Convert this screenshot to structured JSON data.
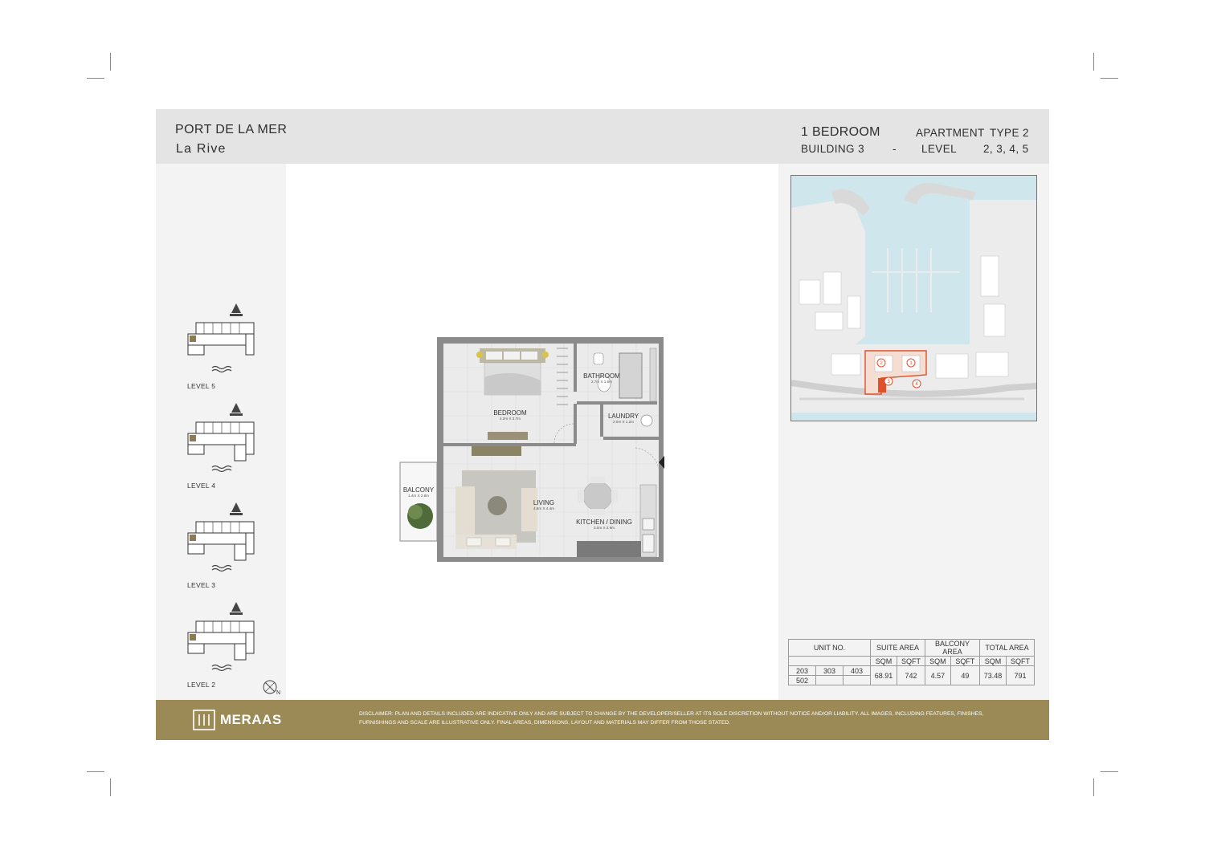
{
  "header": {
    "project": "PORT DE LA MER",
    "subproject": "La Rive",
    "unit_type": "1 BEDROOM",
    "apartment_label": "APARTMENT",
    "apartment_type": "TYPE 2",
    "building": "BUILDING 3",
    "separator": "-",
    "level_label": "LEVEL",
    "levels": "2, 3, 4, 5"
  },
  "keyplans": [
    {
      "label": "LEVEL 5"
    },
    {
      "label": "LEVEL 4"
    },
    {
      "label": "LEVEL 3"
    },
    {
      "label": "LEVEL 2"
    }
  ],
  "compass": {
    "label": "N",
    "icon": "north-compass-icon"
  },
  "floorplan": {
    "rooms": [
      {
        "name": "BEDROOM",
        "dim": "4.2m X 3.7m"
      },
      {
        "name": "BATHROOM",
        "dim": "2.7m X 1.6m"
      },
      {
        "name": "LAUNDRY",
        "dim": "2.0m X 1.2m"
      },
      {
        "name": "BALCONY",
        "dim": "1.4m X 2.8m"
      },
      {
        "name": "LIVING",
        "dim": "4.8m X 4.4m"
      },
      {
        "name": "KITCHEN / DINING",
        "dim": "3.0m X 2.9m"
      }
    ]
  },
  "sitemap": {
    "markers": [
      "1",
      "2",
      "3",
      "4"
    ],
    "highlight_color": "#e0502a",
    "water_color": "#cfe7ec"
  },
  "table": {
    "unit_no_label": "UNIT NO.",
    "suite_area_label": "SUITE AREA",
    "balcony_area_label": "BALCONY AREA",
    "total_area_label": "TOTAL AREA",
    "sqm_label": "SQM",
    "sqft_label": "SQFT",
    "units": [
      "203",
      "303",
      "403",
      "502"
    ],
    "suite_sqm": "68.91",
    "suite_sqft": "742",
    "balcony_sqm": "4.57",
    "balcony_sqft": "49",
    "total_sqm": "73.48",
    "total_sqft": "791"
  },
  "footer": {
    "brand": "MERAAS",
    "disclaimer": "DISCLAIMER: PLAN AND DETAILS INCLUDED ARE INDICATIVE ONLY AND ARE SUBJECT TO CHANGE BY THE DEVELOPER/SELLER AT ITS SOLE DISCRETION WITHOUT NOTICE AND/OR LIABILITY. ALL IMAGES, INCLUDING FEATURES, FINISHES, FURNISHINGS AND SCALE ARE ILLUSTRATIVE ONLY. FINAL AREAS, DIMENSIONS, LAYOUT AND MATERIALS MAY DIFFER FROM THOSE STATED."
  },
  "colors": {
    "header_bg": "#e4e4e4",
    "panel_bg": "#f3f3f3",
    "footer_bg": "#9b8a55"
  }
}
